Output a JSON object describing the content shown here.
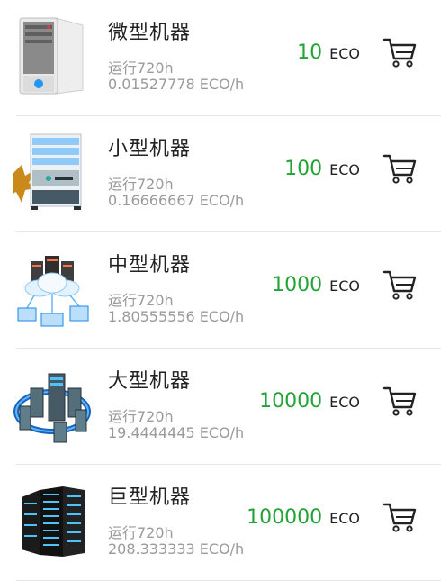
{
  "items": [
    {
      "name": "微型机器",
      "runtime": "运行720h",
      "rate": "0.01527778 ECO/h",
      "price": "10",
      "unit": "ECO",
      "icon": "tower-server-icon"
    },
    {
      "name": "小型机器",
      "runtime": "运行720h",
      "rate": "0.16666667 ECO/h",
      "price": "100",
      "unit": "ECO",
      "icon": "rack-server-icon"
    },
    {
      "name": "中型机器",
      "runtime": "运行720h",
      "rate": "1.80555556 ECO/h",
      "price": "1000",
      "unit": "ECO",
      "icon": "cloud-network-icon"
    },
    {
      "name": "大型机器",
      "runtime": "运行720h",
      "rate": "19.4444445 ECO/h",
      "price": "10000",
      "unit": "ECO",
      "icon": "datacenter-ring-icon"
    },
    {
      "name": "巨型机器",
      "runtime": "运行720h",
      "rate": "208.333333 ECO/h",
      "price": "100000",
      "unit": "ECO",
      "icon": "server-cabinets-icon"
    }
  ],
  "colors": {
    "price": "#22a336",
    "secondary": "#9a9a9a",
    "divider": "#e6e6e6"
  }
}
